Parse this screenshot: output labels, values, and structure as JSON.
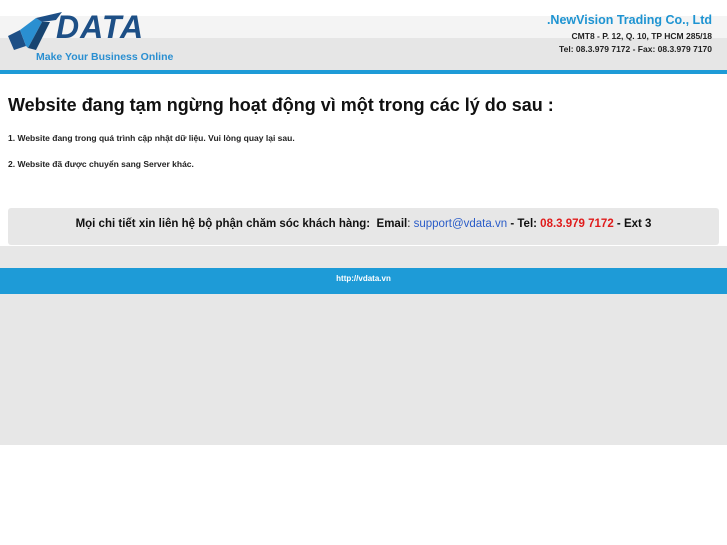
{
  "header": {
    "logo_text": "DATA",
    "logo_tagline": "Make Your Business Online",
    "company_name": ".NewVision Trading Co., Ltd",
    "company_address": "CMT8 - P. 12, Q. 10, TP HCM 285/18",
    "company_phone": "Tel: 08.3.979 7172 - Fax: 08.3.979 7170"
  },
  "main": {
    "title": "Website đang tạm ngừng hoạt động vì một trong các lý do sau :",
    "reasons": [
      "1. Website đang trong quá trình cập nhật dữ liệu. Vui lòng quay lại sau.",
      "2. Website đã được chuyển sang Server khác."
    ]
  },
  "contact": {
    "prefix": "Mọi chi tiết xin liên hệ bộ phận chăm sóc khách hàng:",
    "email_label": "Email",
    "email": "support@vdata.vn",
    "tel_label": "Tel:",
    "phone": "08.3.979 7172",
    "ext": "- Ext 3"
  },
  "footer": {
    "link": "http://vdata.vn"
  },
  "colors": {
    "accent_blue": "#1e9bd7",
    "logo_navy": "#1d4f86",
    "email_blue": "#2a5cc8",
    "phone_red": "#e01b1b",
    "panel_gray": "#e7e7e7"
  }
}
